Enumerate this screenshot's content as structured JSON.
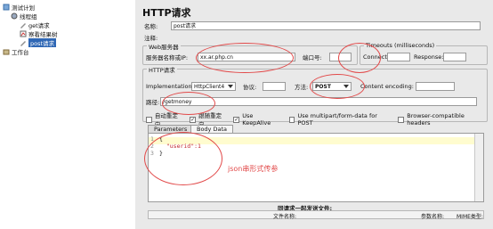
{
  "tree": {
    "items": [
      {
        "label": "测试计划"
      },
      {
        "label": "线程组"
      },
      {
        "label": "get请求"
      },
      {
        "label": "察看结果树"
      },
      {
        "label": "post请求"
      },
      {
        "label": "工作台"
      }
    ]
  },
  "panel": {
    "title": "HTTP请求",
    "name_label": "名称:",
    "name_value": "post请求",
    "comment_label": "注释:",
    "web_server_group": "Web服务器",
    "server_label": "服务器名称或IP:",
    "server_value": "xx.ar.php.cn",
    "port_label": "端口号:",
    "port_value": "",
    "timeouts_group": "Timeouts (milliseconds)",
    "connect_label": "Connect:",
    "response_label": "Response:",
    "http_group": "HTTP请求",
    "impl_label": "Implementation:",
    "impl_value": "HttpClient4",
    "protocol_label": "协议:",
    "method_label": "方法:",
    "method_value": "POST",
    "encoding_label": "Content encoding:",
    "path_label": "路径:",
    "path_value": "/getmoney",
    "checkboxes": [
      {
        "label": "自动重定向",
        "checked": false
      },
      {
        "label": "跟随重定向",
        "checked": true
      },
      {
        "label": "Use KeepAlive",
        "checked": true
      },
      {
        "label": "Use multipart/form-data for POST",
        "checked": false
      },
      {
        "label": "Browser-compatible headers",
        "checked": false
      }
    ],
    "tabs": [
      {
        "label": "Parameters"
      },
      {
        "label": "Body Data"
      }
    ],
    "code_lines": [
      "{",
      "  \"userid\":1",
      "}"
    ],
    "line_numbers": [
      "1",
      "2",
      "3"
    ],
    "annotation": "json串形式传参",
    "files_title": "同请求一起发送文件:",
    "files_cols": [
      "文件名称:",
      "参数名称:",
      "MIME类型:"
    ]
  }
}
